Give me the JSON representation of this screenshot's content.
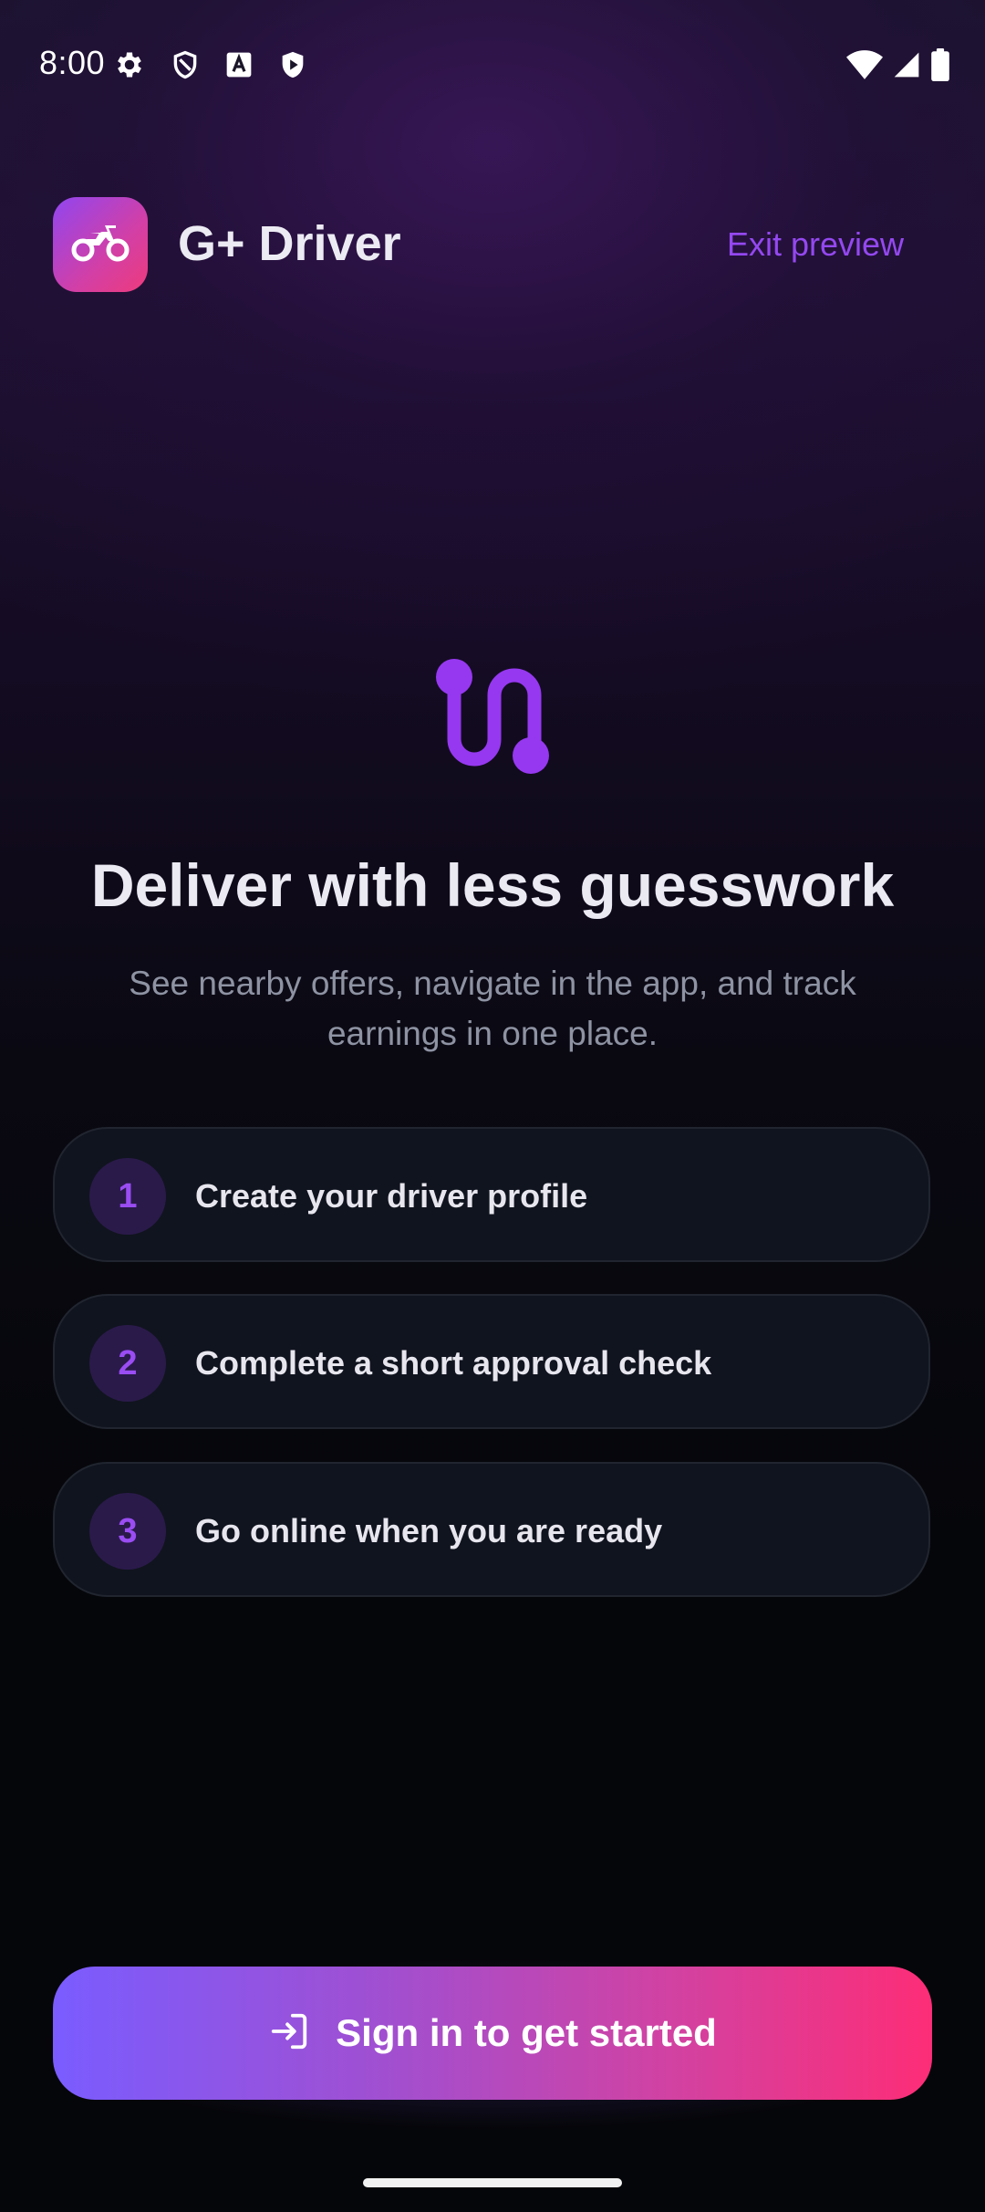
{
  "status_bar": {
    "time": "8:00",
    "icons_left": [
      "gear-icon",
      "shield-icon",
      "font-a-icon",
      "play-protect-icon"
    ],
    "icons_right": [
      "wifi-icon",
      "signal-icon",
      "battery-icon"
    ]
  },
  "header": {
    "app_name": "G+ Driver",
    "logo_icon": "motorcycle-icon",
    "exit_label": "Exit preview"
  },
  "hero": {
    "icon": "route-icon",
    "title": "Deliver with less guesswork",
    "subtitle": "See nearby offers, navigate in the app, and track earnings in one place."
  },
  "steps": [
    {
      "number": "1",
      "label": "Create your driver profile"
    },
    {
      "number": "2",
      "label": "Complete a short approval check"
    },
    {
      "number": "3",
      "label": "Go online when you are ready"
    }
  ],
  "cta": {
    "icon": "sign-in-icon",
    "label": "Sign in to get started"
  },
  "colors": {
    "accent_purple": "#9448f0",
    "gradient_start": "#7a5cff",
    "gradient_end": "#fd2d77",
    "card_background": "#10141e",
    "background": "#05060a"
  }
}
